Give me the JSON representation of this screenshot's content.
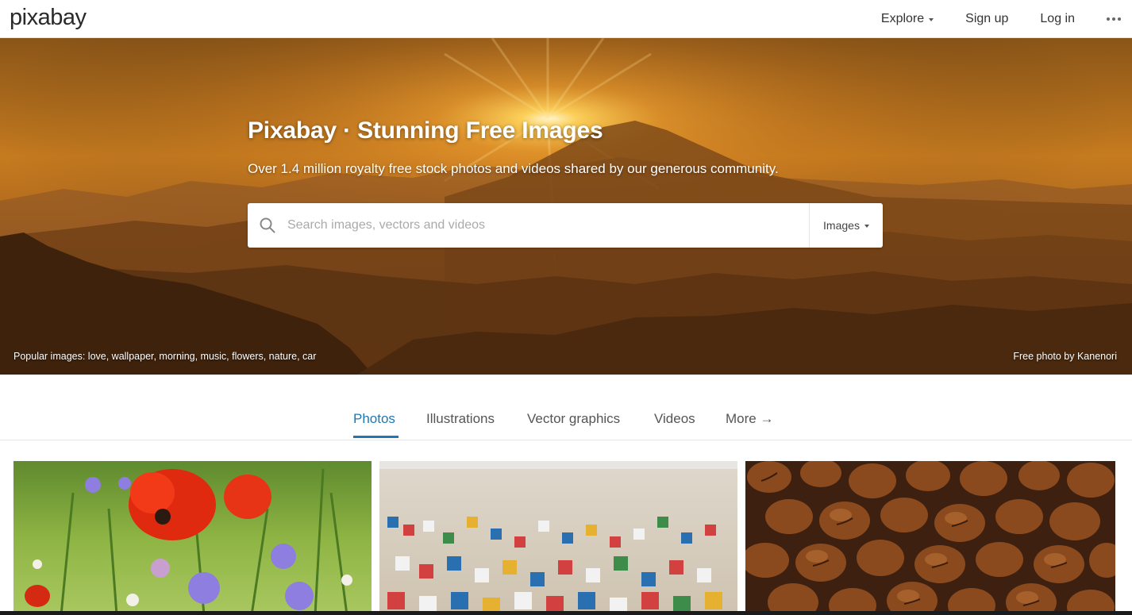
{
  "header": {
    "logo": "pixabay",
    "nav": {
      "explore": "Explore",
      "signup": "Sign up",
      "login": "Log in"
    },
    "icons": {
      "more": "more-dots-icon",
      "caret": "caret-down-icon"
    }
  },
  "hero": {
    "title": "Pixabay · Stunning Free Images",
    "subtitle": "Over 1.4 million royalty free stock photos and videos shared by our generous community.",
    "search": {
      "placeholder": "Search images, vectors and videos",
      "type": "Images",
      "icon": "search-icon"
    },
    "popular": "Popular images: love, wallpaper, morning, music, flowers, nature, car",
    "credit": "Free photo by Kanenori"
  },
  "tabs": [
    {
      "label": "Photos",
      "active": true
    },
    {
      "label": "Illustrations"
    },
    {
      "label": "Vector graphics"
    },
    {
      "label": "Videos"
    },
    {
      "label": "More →"
    }
  ],
  "colors": {
    "accent": "#1d78b4",
    "text": "#333333",
    "divider": "#e6e6e6"
  }
}
